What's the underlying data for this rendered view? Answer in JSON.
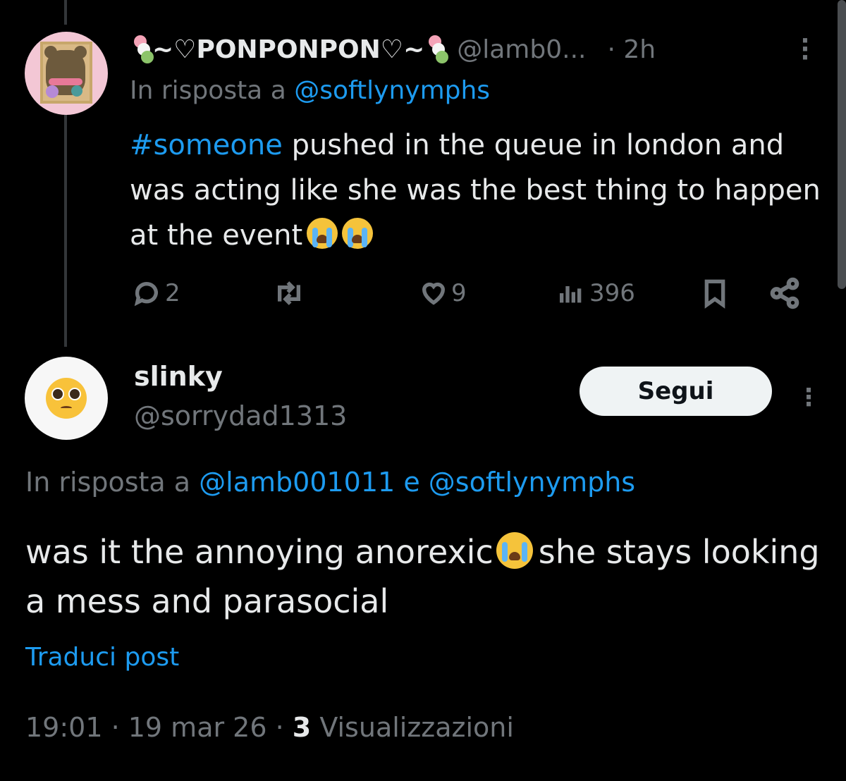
{
  "tweet1": {
    "display_name": "~♡PONPONPON♡~",
    "handle": "@lamb0...",
    "time": "· 2h",
    "reply_prefix": "In risposta a",
    "reply_to": "@softlynymphs",
    "hashtag": "#someone",
    "body_text": "pushed in the queue in london and was acting like she was the best thing to happen at the event",
    "stats": {
      "replies": "2",
      "likes": "9",
      "views": "396"
    }
  },
  "tweet2": {
    "display_name": "slinky",
    "handle": "@sorrydad1313",
    "follow_label": "Segui",
    "reply_prefix": "In risposta a",
    "reply_to_1": "@lamb001011",
    "reply_join": "e",
    "reply_to_2": "@softlynymphs",
    "body_before_emoji": "was it the annoying anorexic",
    "body_after_emoji": "she stays looking a mess and parasocial",
    "translate_label": "Traduci post",
    "timestamp": "19:01 · 19 mar 26 ·",
    "view_count": "3",
    "views_label": "Visualizzazioni"
  },
  "colors": {
    "background": "#000000",
    "text": "#e7e9ea",
    "muted": "#71767b",
    "link": "#1d9bf0"
  },
  "icons": [
    "reply-icon",
    "repost-icon",
    "like-icon",
    "views-icon",
    "bookmark-icon",
    "share-icon",
    "more-icon",
    "crying-emoji",
    "pleading-emoji",
    "dango-emoji"
  ]
}
